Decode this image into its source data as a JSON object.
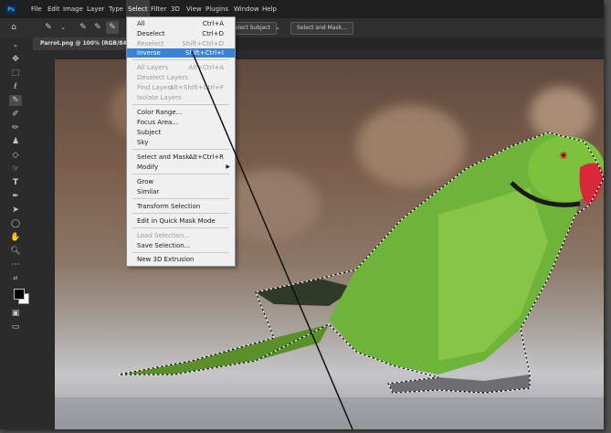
{
  "app": {
    "logo": "Ps",
    "menus": [
      "File",
      "Edit",
      "Image",
      "Layer",
      "Type",
      "Select",
      "Filter",
      "3D",
      "View",
      "Plugins",
      "Window",
      "Help"
    ],
    "active_menu": "Select"
  },
  "options_bar": {
    "select_subject_label": "elect Subject",
    "select_and_mask_label": "Select and Mask..."
  },
  "document": {
    "tab_title": "Parrot.png @ 100% (RGB/8#) *"
  },
  "select_menu": {
    "items": [
      {
        "label": "All",
        "shortcut": "Ctrl+A",
        "state": "enabled"
      },
      {
        "label": "Deselect",
        "shortcut": "Ctrl+D",
        "state": "enabled"
      },
      {
        "label": "Reselect",
        "shortcut": "Shift+Ctrl+D",
        "state": "disabled"
      },
      {
        "label": "Inverse",
        "shortcut": "Shift+Ctrl+I",
        "state": "highlighted"
      },
      {
        "label": "All Layers",
        "shortcut": "Alt+Ctrl+A",
        "state": "disabled"
      },
      {
        "label": "Deselect Layers",
        "shortcut": "",
        "state": "disabled"
      },
      {
        "label": "Find Layers",
        "shortcut": "Alt+Shift+Ctrl+F",
        "state": "disabled"
      },
      {
        "label": "Isolate Layers",
        "shortcut": "",
        "state": "disabled"
      },
      {
        "label": "Color Range...",
        "shortcut": "",
        "state": "enabled"
      },
      {
        "label": "Focus Area...",
        "shortcut": "",
        "state": "enabled"
      },
      {
        "label": "Subject",
        "shortcut": "",
        "state": "enabled"
      },
      {
        "label": "Sky",
        "shortcut": "",
        "state": "enabled"
      },
      {
        "label": "Select and Mask...",
        "shortcut": "Alt+Ctrl+R",
        "state": "enabled"
      },
      {
        "label": "Modify",
        "shortcut": "",
        "state": "enabled"
      },
      {
        "label": "Grow",
        "shortcut": "",
        "state": "enabled"
      },
      {
        "label": "Similar",
        "shortcut": "",
        "state": "enabled"
      },
      {
        "label": "Transform Selection",
        "shortcut": "",
        "state": "enabled"
      },
      {
        "label": "Edit in Quick Mask Mode",
        "shortcut": "",
        "state": "enabled"
      },
      {
        "label": "Load Selection...",
        "shortcut": "",
        "state": "disabled"
      },
      {
        "label": "Save Selection...",
        "shortcut": "",
        "state": "enabled"
      },
      {
        "label": "New 3D Extrusion",
        "shortcut": "",
        "state": "enabled"
      }
    ]
  },
  "icons": {
    "home": "home-icon",
    "brush": "quick-selection-icon",
    "move": "move-icon"
  },
  "colors": {
    "accent_highlight": "#3a82d6",
    "foreground_swatch": "#000000",
    "background_swatch": "#ffffff"
  }
}
